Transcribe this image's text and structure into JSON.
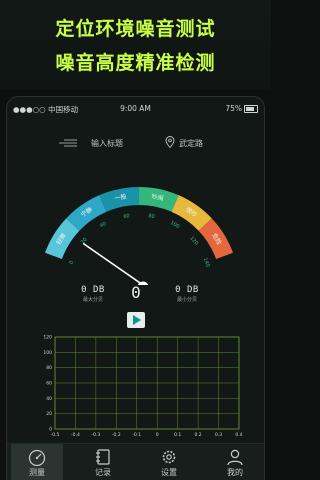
{
  "promo": {
    "line1": "定位环境噪音测试",
    "line2": "噪音高度精准检测"
  },
  "statusbar": {
    "carrier": "●●●○○ 中国移动 ",
    "time": "9:00 AM",
    "battery": "75%"
  },
  "navbar": {
    "title_placeholder": "输入标题",
    "location": "武定路"
  },
  "gauge": {
    "value_db": 0,
    "needle_at_db": 18,
    "min": 0,
    "max": 140,
    "bands": [
      {
        "label": "轻微",
        "color": "#57c6d8"
      },
      {
        "label": "宁静",
        "color": "#2fa7c8"
      },
      {
        "label": "一般",
        "color": "#1a93a8"
      },
      {
        "label": "吵闹",
        "color": "#35b77b"
      },
      {
        "label": "很吵",
        "color": "#e8b83c"
      },
      {
        "label": "危险",
        "color": "#e5673d"
      }
    ],
    "ticks": [
      "0",
      "20",
      "40",
      "60",
      "80",
      "100",
      "120",
      "140"
    ]
  },
  "readouts": {
    "big": "0",
    "max_value": "0 DB",
    "max_label": "最大分贝",
    "min_value": "0 DB",
    "min_label": "最小分贝"
  },
  "chart_data": {
    "type": "line",
    "title": "",
    "xlabel": "",
    "ylabel": "",
    "x_ticks": [
      "-0.5",
      "-0.4",
      "-0.3",
      "-0.2",
      "-0.1",
      "0",
      "0.1",
      "0.2",
      "0.3",
      "0.4"
    ],
    "y_ticks": [
      "0",
      "20",
      "40",
      "60",
      "80",
      "100",
      "120"
    ],
    "ylim": [
      0,
      120
    ],
    "grid": true,
    "series": []
  },
  "tabbar": {
    "items": [
      {
        "label": "测量",
        "icon": "gauge-icon"
      },
      {
        "label": "记录",
        "icon": "record-icon"
      },
      {
        "label": "设置",
        "icon": "gear-icon"
      },
      {
        "label": "我的",
        "icon": "user-icon"
      }
    ]
  }
}
